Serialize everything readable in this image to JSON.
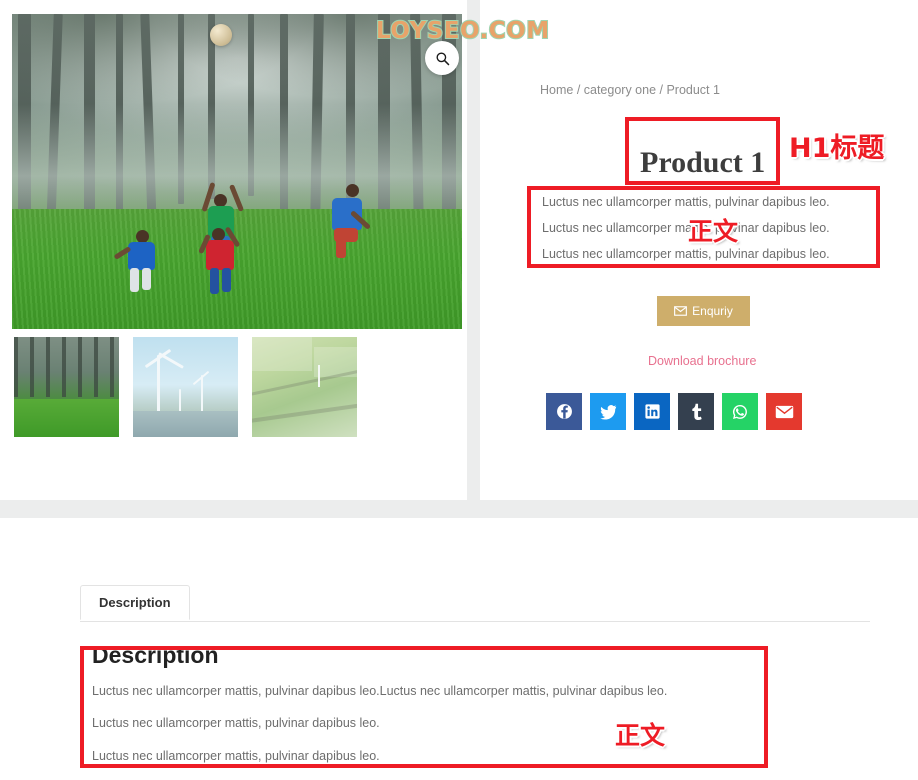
{
  "gallery": {
    "main_image_alt": "Four children playing with a ball in a misty forest",
    "zoom_icon": "magnifier-icon",
    "watermark": "LOYSEO.COM",
    "thumbnails": [
      {
        "alt": "Children playing ball in forest",
        "name": "thumbnail-forest-kids"
      },
      {
        "alt": "Wind turbines over water",
        "name": "thumbnail-wind-turbines"
      },
      {
        "alt": "Aerial view of green fields",
        "name": "thumbnail-green-fields"
      }
    ]
  },
  "summary": {
    "breadcrumb": "Home / category one / Product 1",
    "title": "Product 1",
    "intro_paragraphs": [
      "Luctus nec ullamcorper mattis, pulvinar dapibus leo.",
      "Luctus nec ullamcorper mattis, pulvinar dapibus leo.",
      "Luctus nec ullamcorper mattis, pulvinar dapibus leo."
    ],
    "enquiry_label": "Enquriy",
    "enquiry_icon": "envelope-icon",
    "download_label": "Download brochure",
    "socials": [
      {
        "name": "facebook",
        "label": "Facebook",
        "color": "#3b5998"
      },
      {
        "name": "twitter",
        "label": "Twitter",
        "color": "#1d9bf0"
      },
      {
        "name": "linkedin",
        "label": "LinkedIn",
        "color": "#0a66c2"
      },
      {
        "name": "tumblr",
        "label": "Tumblr",
        "color": "#34404f"
      },
      {
        "name": "whatsapp",
        "label": "WhatsApp",
        "color": "#25d366"
      },
      {
        "name": "email",
        "label": "Email",
        "color": "#e4392e"
      }
    ]
  },
  "description_section": {
    "tab_label": "Description",
    "heading": "Description",
    "paragraphs": [
      "Luctus nec ullamcorper mattis, pulvinar dapibus leo.Luctus nec ullamcorper mattis, pulvinar dapibus leo.",
      "Luctus nec ullamcorper mattis, pulvinar dapibus leo.",
      "Luctus nec ullamcorper mattis, pulvinar dapibus leo."
    ]
  },
  "annotations": {
    "color": "#ee1c25",
    "h1_label": "H1标题",
    "intro_label": "正文",
    "description_label": "正文"
  }
}
